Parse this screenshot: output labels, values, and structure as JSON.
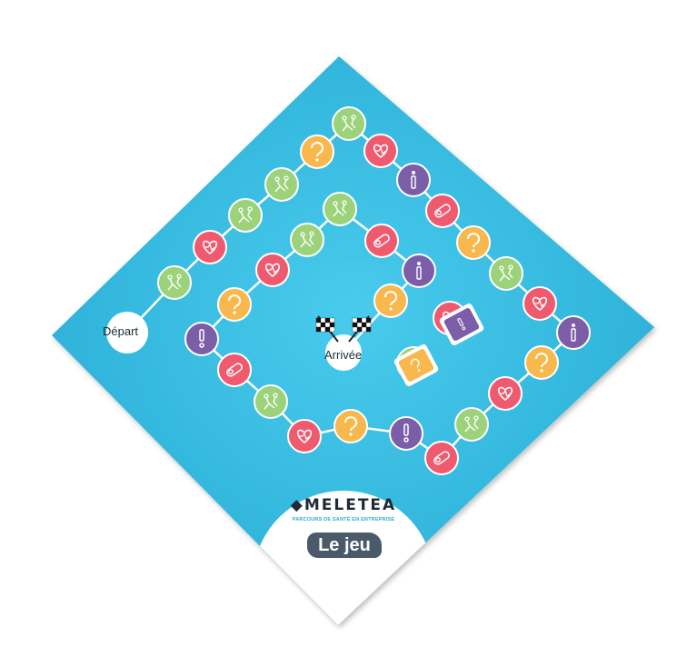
{
  "board": {
    "start_label": "Départ",
    "finish_label": "Arrivée",
    "brand_name": "MELETEA",
    "tagline": "PARCOURS DE SANTÉ EN ENTREPRISE",
    "game_badge": "Le jeu",
    "colors": {
      "board": "#2fb7dd",
      "board_center": "#46c9ea",
      "track": "#ffffff",
      "red": "#ef5a6f",
      "purple": "#7b5ea7",
      "orange": "#f8b84e",
      "green": "#9bd27a"
    }
  },
  "path_spaces": [
    {
      "kind": "heart",
      "color": "red"
    },
    {
      "kind": "stretch",
      "color": "green"
    },
    {
      "kind": "stretch",
      "color": "green"
    },
    {
      "kind": "stretch",
      "color": "green"
    },
    {
      "kind": "question",
      "color": "orange"
    },
    {
      "kind": "stretch",
      "color": "green"
    },
    {
      "kind": "heart",
      "color": "red"
    },
    {
      "kind": "info",
      "color": "purple"
    },
    {
      "kind": "weight",
      "color": "red"
    },
    {
      "kind": "question",
      "color": "orange"
    },
    {
      "kind": "stretch",
      "color": "green"
    },
    {
      "kind": "heart",
      "color": "red"
    },
    {
      "kind": "info",
      "color": "purple"
    },
    {
      "kind": "question",
      "color": "orange"
    },
    {
      "kind": "heart",
      "color": "red"
    },
    {
      "kind": "stretch",
      "color": "green"
    },
    {
      "kind": "weight",
      "color": "red"
    },
    {
      "kind": "alert",
      "color": "purple"
    },
    {
      "kind": "question",
      "color": "orange"
    },
    {
      "kind": "heart",
      "color": "red"
    },
    {
      "kind": "stretch",
      "color": "green"
    },
    {
      "kind": "weight",
      "color": "red"
    },
    {
      "kind": "alert",
      "color": "purple"
    },
    {
      "kind": "question",
      "color": "orange"
    },
    {
      "kind": "heart",
      "color": "red"
    },
    {
      "kind": "stretch",
      "color": "green"
    },
    {
      "kind": "stretch",
      "color": "green"
    },
    {
      "kind": "weight",
      "color": "red"
    },
    {
      "kind": "info",
      "color": "purple"
    },
    {
      "kind": "question",
      "color": "orange"
    },
    {
      "kind": "heart",
      "color": "red"
    },
    {
      "kind": "stretch",
      "color": "green"
    }
  ],
  "cards": [
    {
      "kind": "alert",
      "color": "purple"
    },
    {
      "kind": "question",
      "color": "orange"
    }
  ]
}
